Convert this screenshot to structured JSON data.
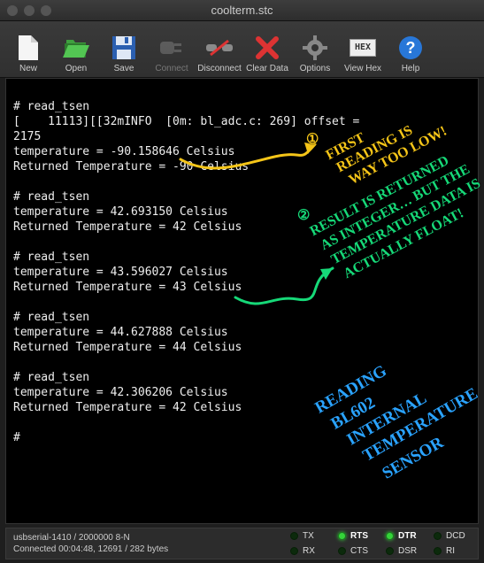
{
  "window": {
    "title": "coolterm.stc"
  },
  "toolbar": {
    "new": "New",
    "open": "Open",
    "save": "Save",
    "connect": "Connect",
    "disconnect": "Disconnect",
    "clear": "Clear Data",
    "options": "Options",
    "viewhex": "View Hex",
    "help": "Help"
  },
  "terminal": {
    "lines": [
      "",
      "# read_tsen",
      "[    11113][[32mINFO  [0m: bl_adc.c: 269] offset = ",
      "2175",
      "temperature = -90.158646 Celsius",
      "Returned Temperature = -90 Celsius",
      "",
      "# read_tsen",
      "temperature = 42.693150 Celsius",
      "Returned Temperature = 42 Celsius",
      "",
      "# read_tsen",
      "temperature = 43.596027 Celsius",
      "Returned Temperature = 43 Celsius",
      "",
      "# read_tsen",
      "temperature = 44.627888 Celsius",
      "Returned Temperature = 44 Celsius",
      "",
      "# read_tsen",
      "temperature = 42.306206 Celsius",
      "Returned Temperature = 42 Celsius",
      "",
      "# "
    ]
  },
  "status": {
    "port": "usbserial-1410 / 2000000 8-N",
    "conn": "Connected 00:04:48, 12691 / 282 bytes",
    "leds": {
      "tx": {
        "label": "TX",
        "on": false,
        "bold": false
      },
      "rx": {
        "label": "RX",
        "on": false,
        "bold": false
      },
      "rts": {
        "label": "RTS",
        "on": true,
        "bold": true
      },
      "cts": {
        "label": "CTS",
        "on": false,
        "bold": false
      },
      "dtr": {
        "label": "DTR",
        "on": true,
        "bold": true
      },
      "dsr": {
        "label": "DSR",
        "on": false,
        "bold": false
      },
      "dcd": {
        "label": "DCD",
        "on": false,
        "bold": false
      },
      "ri": {
        "label": "RI",
        "on": false,
        "bold": false
      }
    }
  },
  "annotations": {
    "a1_num": "①",
    "a1_l1": "FIRST",
    "a1_l2": "READING IS",
    "a1_l3": "WAY TOO LOW!",
    "a2_num": "②",
    "a2_l1": "RESULT IS RETURNED",
    "a2_l2": "AS INTEGER… BUT THE",
    "a2_l3": "TEMPERATURE DATA IS",
    "a2_l4": "ACTUALLY FLOAT!",
    "a3_l1": "READING",
    "a3_l2": "BL602",
    "a3_l3": "INTERNAL",
    "a3_l4": "TEMPERATURE",
    "a3_l5": "SENSOR",
    "colors": {
      "yellow": "#f5c518",
      "green": "#16d978",
      "blue": "#2aa3ff"
    }
  }
}
